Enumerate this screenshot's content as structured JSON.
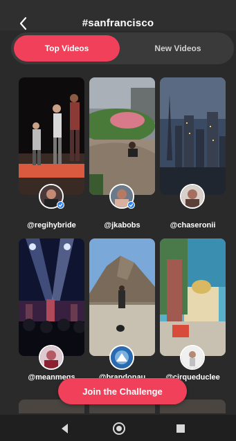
{
  "header": {
    "title": "#sanfrancisco",
    "back_icon": "chevron-left-icon"
  },
  "tabs": [
    {
      "label": "Top Videos",
      "active": true
    },
    {
      "label": "New Videos",
      "active": false
    }
  ],
  "videos": [
    {
      "handle": "@regihybride",
      "verified": true
    },
    {
      "handle": "@jkabobs",
      "verified": true
    },
    {
      "handle": "@chaseronii",
      "verified": false
    },
    {
      "handle": "@meanmegs",
      "verified": false
    },
    {
      "handle": "@brandonau",
      "verified": false
    },
    {
      "handle": "@cirqueduclee",
      "verified": false
    }
  ],
  "cta": {
    "label": "Join the Challenge"
  },
  "navbar": {
    "back_icon": "triangle-back-icon",
    "home_icon": "circle-home-icon",
    "recents_icon": "square-recents-icon"
  },
  "colors": {
    "accent": "#f0405a",
    "background": "#2a2a2a",
    "tab_track": "#3a3a3a",
    "verified": "#2f80ed"
  }
}
